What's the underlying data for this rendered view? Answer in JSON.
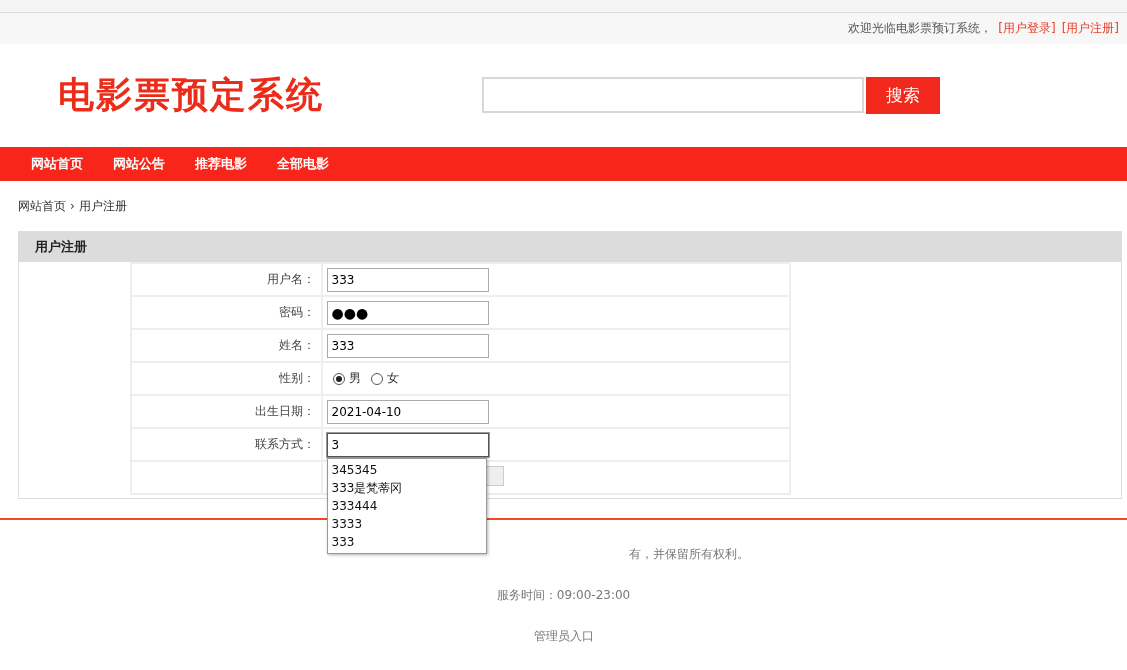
{
  "top_bar": {
    "welcome": "欢迎光临电影票预订系统，",
    "links": [
      "[用户登录]",
      "[用户注册]"
    ]
  },
  "header": {
    "logo": "电影票预定系统",
    "search": {
      "button": "搜索"
    }
  },
  "nav": [
    "网站首页",
    "网站公告",
    "推荐电影",
    "全部电影"
  ],
  "breadcrumb": {
    "home": "网站首页",
    "separator": "›",
    "current": "用户注册"
  },
  "panel": {
    "title": "用户注册",
    "fields": [
      {
        "kind": "text",
        "label": "用户名：",
        "value": "333"
      },
      {
        "kind": "password",
        "label": "密码：",
        "value": "●●●"
      },
      {
        "kind": "text",
        "label": "姓名：",
        "value": "333"
      },
      {
        "kind": "radio",
        "label": "性别：",
        "options": [
          {
            "label": "男",
            "selected": true
          },
          {
            "label": "女",
            "selected": false
          }
        ]
      },
      {
        "kind": "text",
        "label": "出生日期：",
        "value": "2021-04-10"
      },
      {
        "kind": "text",
        "label": "联系方式：",
        "value": "3",
        "focused": true
      }
    ],
    "autocomplete": [
      "345345",
      "333是梵蒂冈",
      "333444",
      "3333",
      "333"
    ]
  },
  "footer": {
    "copyright": "有，并保留所有权利。",
    "hours": "服务时间：09:00-23:00",
    "admin_link": "管理员入口"
  }
}
